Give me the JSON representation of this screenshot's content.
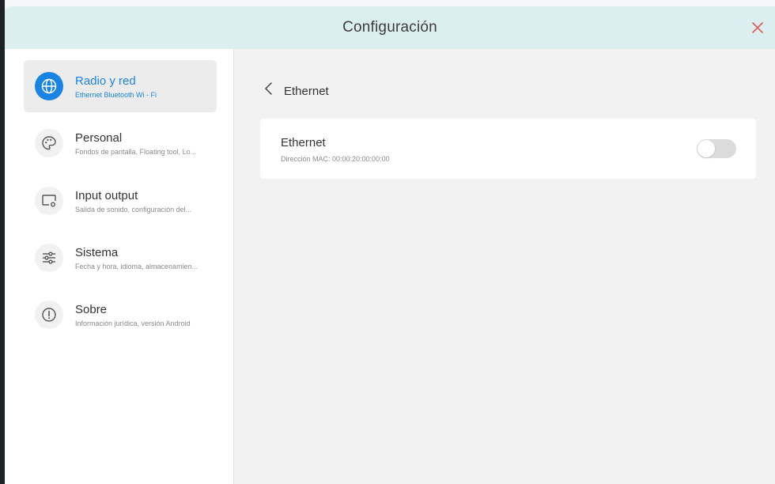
{
  "window": {
    "title": "Configuración"
  },
  "sidebar": {
    "items": [
      {
        "label": "Radio y red",
        "subtitle": "Ethernet Bluetooth Wi - Fi",
        "icon": "globe-icon",
        "active": true
      },
      {
        "label": "Personal",
        "subtitle": "Fondos de pantalla, Floating tool, Lo...",
        "icon": "palette-icon",
        "active": false
      },
      {
        "label": "Input output",
        "subtitle": "Salida de sonido, configuración del...",
        "icon": "display-settings-icon",
        "active": false
      },
      {
        "label": "Sistema",
        "subtitle": "Fecha y hora, idioma, almacenamien...",
        "icon": "sliders-icon",
        "active": false
      },
      {
        "label": "Sobre",
        "subtitle": "Información jurídica, versión Android",
        "icon": "info-icon",
        "active": false
      }
    ]
  },
  "content": {
    "page_title": "Ethernet",
    "card": {
      "title": "Ethernet",
      "subtitle": "Dirección MAC: 00:00:20:00:00:00",
      "toggle_on": false
    }
  },
  "colors": {
    "accent": "#1a84e4",
    "titlebar_bg": "#dbf0ee",
    "close": "#e05a5a",
    "content_bg": "#f2f2f2"
  }
}
